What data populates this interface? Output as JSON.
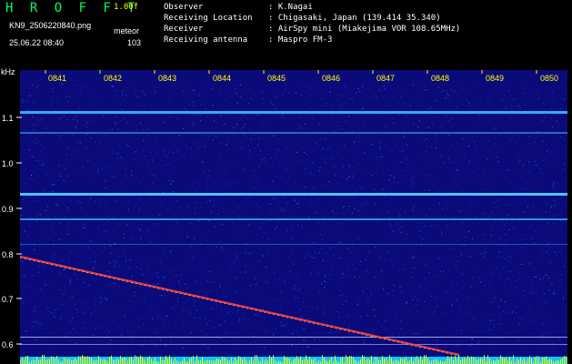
{
  "app": {
    "title": "H R O F F T",
    "version": "1.00f",
    "file_name": "KN9_2506220840.png",
    "mode": "meteor",
    "date_time": "25.06.22 08:40",
    "count": "103"
  },
  "info": [
    {
      "label": "Observer",
      "value": ": K.Nagai"
    },
    {
      "label": "Receiving Location",
      "value": ": Chigasaki, Japan (139.414 35.340)"
    },
    {
      "label": "Receiver",
      "value": ": AirSpy mini (Miakejima VOR 108.65MHz)"
    },
    {
      "label": "Receiving antenna",
      "value": ": Maspro FM-3"
    }
  ],
  "axis": {
    "unit": "kHz",
    "y_ticks": [
      "1.1",
      "1.0",
      "0.9",
      "0.8",
      "0.7",
      "0.6"
    ],
    "time_ticks": [
      "0841",
      "0842",
      "0843",
      "0844",
      "0845",
      "0846",
      "0847",
      "0848",
      "0849",
      "0850"
    ]
  },
  "colors": {
    "background": "#000000",
    "spectrogram_bg": "#0a0a7a",
    "carrier_line": "#40c8ff",
    "meteor_trail": "#ff5050",
    "title": "#00ff66",
    "time_label": "#ffff00"
  }
}
